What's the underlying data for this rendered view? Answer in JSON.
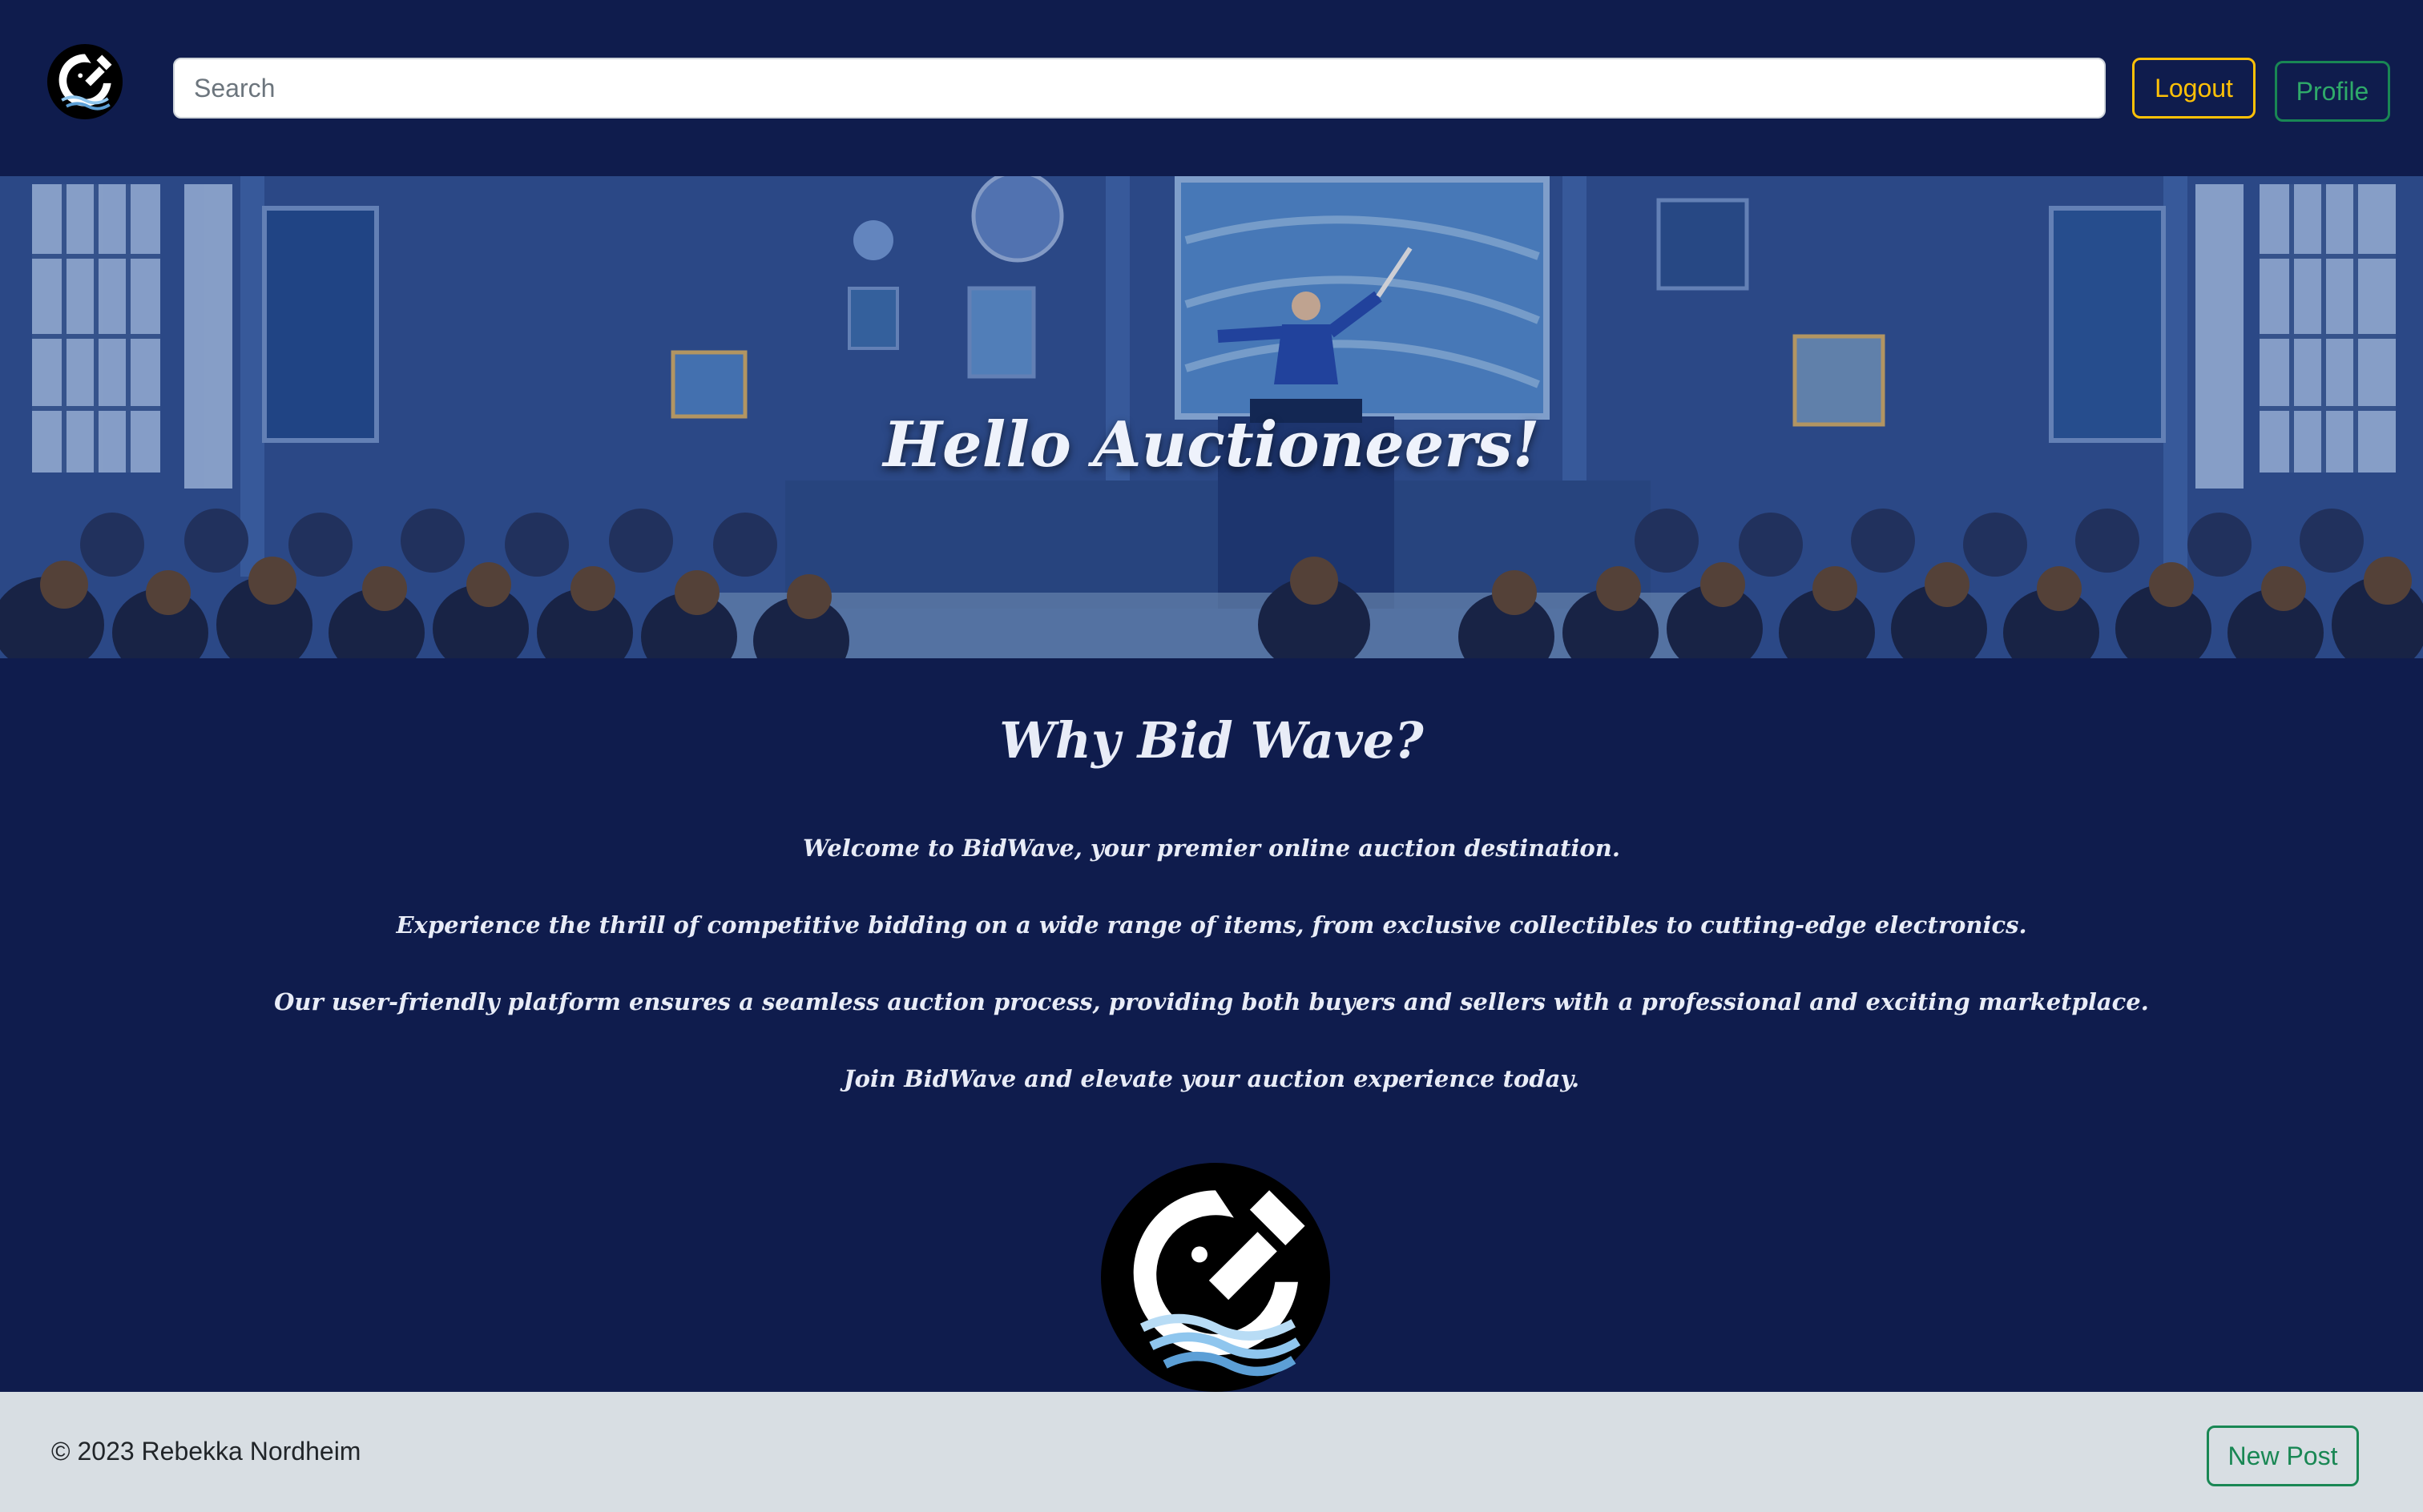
{
  "header": {
    "logo_icon": "bidwave-logo-icon",
    "search": {
      "placeholder": "Search",
      "value": ""
    },
    "logout_label": "Logout",
    "profile_label": "Profile"
  },
  "hero": {
    "title": "Hello Auctioneers!"
  },
  "main": {
    "title": "Why Bid Wave?",
    "paragraphs": [
      "Welcome to BidWave, your premier online auction destination.",
      "Experience the thrill of competitive bidding on a wide range of items, from exclusive collectibles to cutting-edge electronics.",
      "Our user-friendly platform ensures a seamless auction process, providing both buyers and sellers with a professional and exciting marketplace.",
      "Join BidWave and elevate your auction experience today."
    ]
  },
  "footer": {
    "copyright": "© 2023 Rebekka Nordheim",
    "new_post_label": "New Post"
  },
  "colors": {
    "page_bg": "#0f1c4d",
    "footer_bg": "#d8dee3",
    "warning": "#ffc107",
    "success": "#198754"
  }
}
